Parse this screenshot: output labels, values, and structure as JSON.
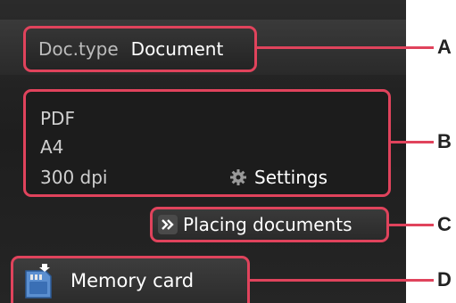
{
  "doc_type": {
    "label": "Doc.type",
    "value": "Document"
  },
  "scan_settings": {
    "format": "PDF",
    "paper_size": "A4",
    "resolution": "300 dpi",
    "settings_label": "Settings"
  },
  "placing_documents": {
    "label": "Placing documents"
  },
  "destination": {
    "label": "Memory card"
  },
  "callouts": [
    "A",
    "B",
    "C",
    "D"
  ],
  "colors": {
    "highlight": "#e0435c",
    "panel_bg": "#1e1e1e",
    "text": "#ffffff"
  }
}
